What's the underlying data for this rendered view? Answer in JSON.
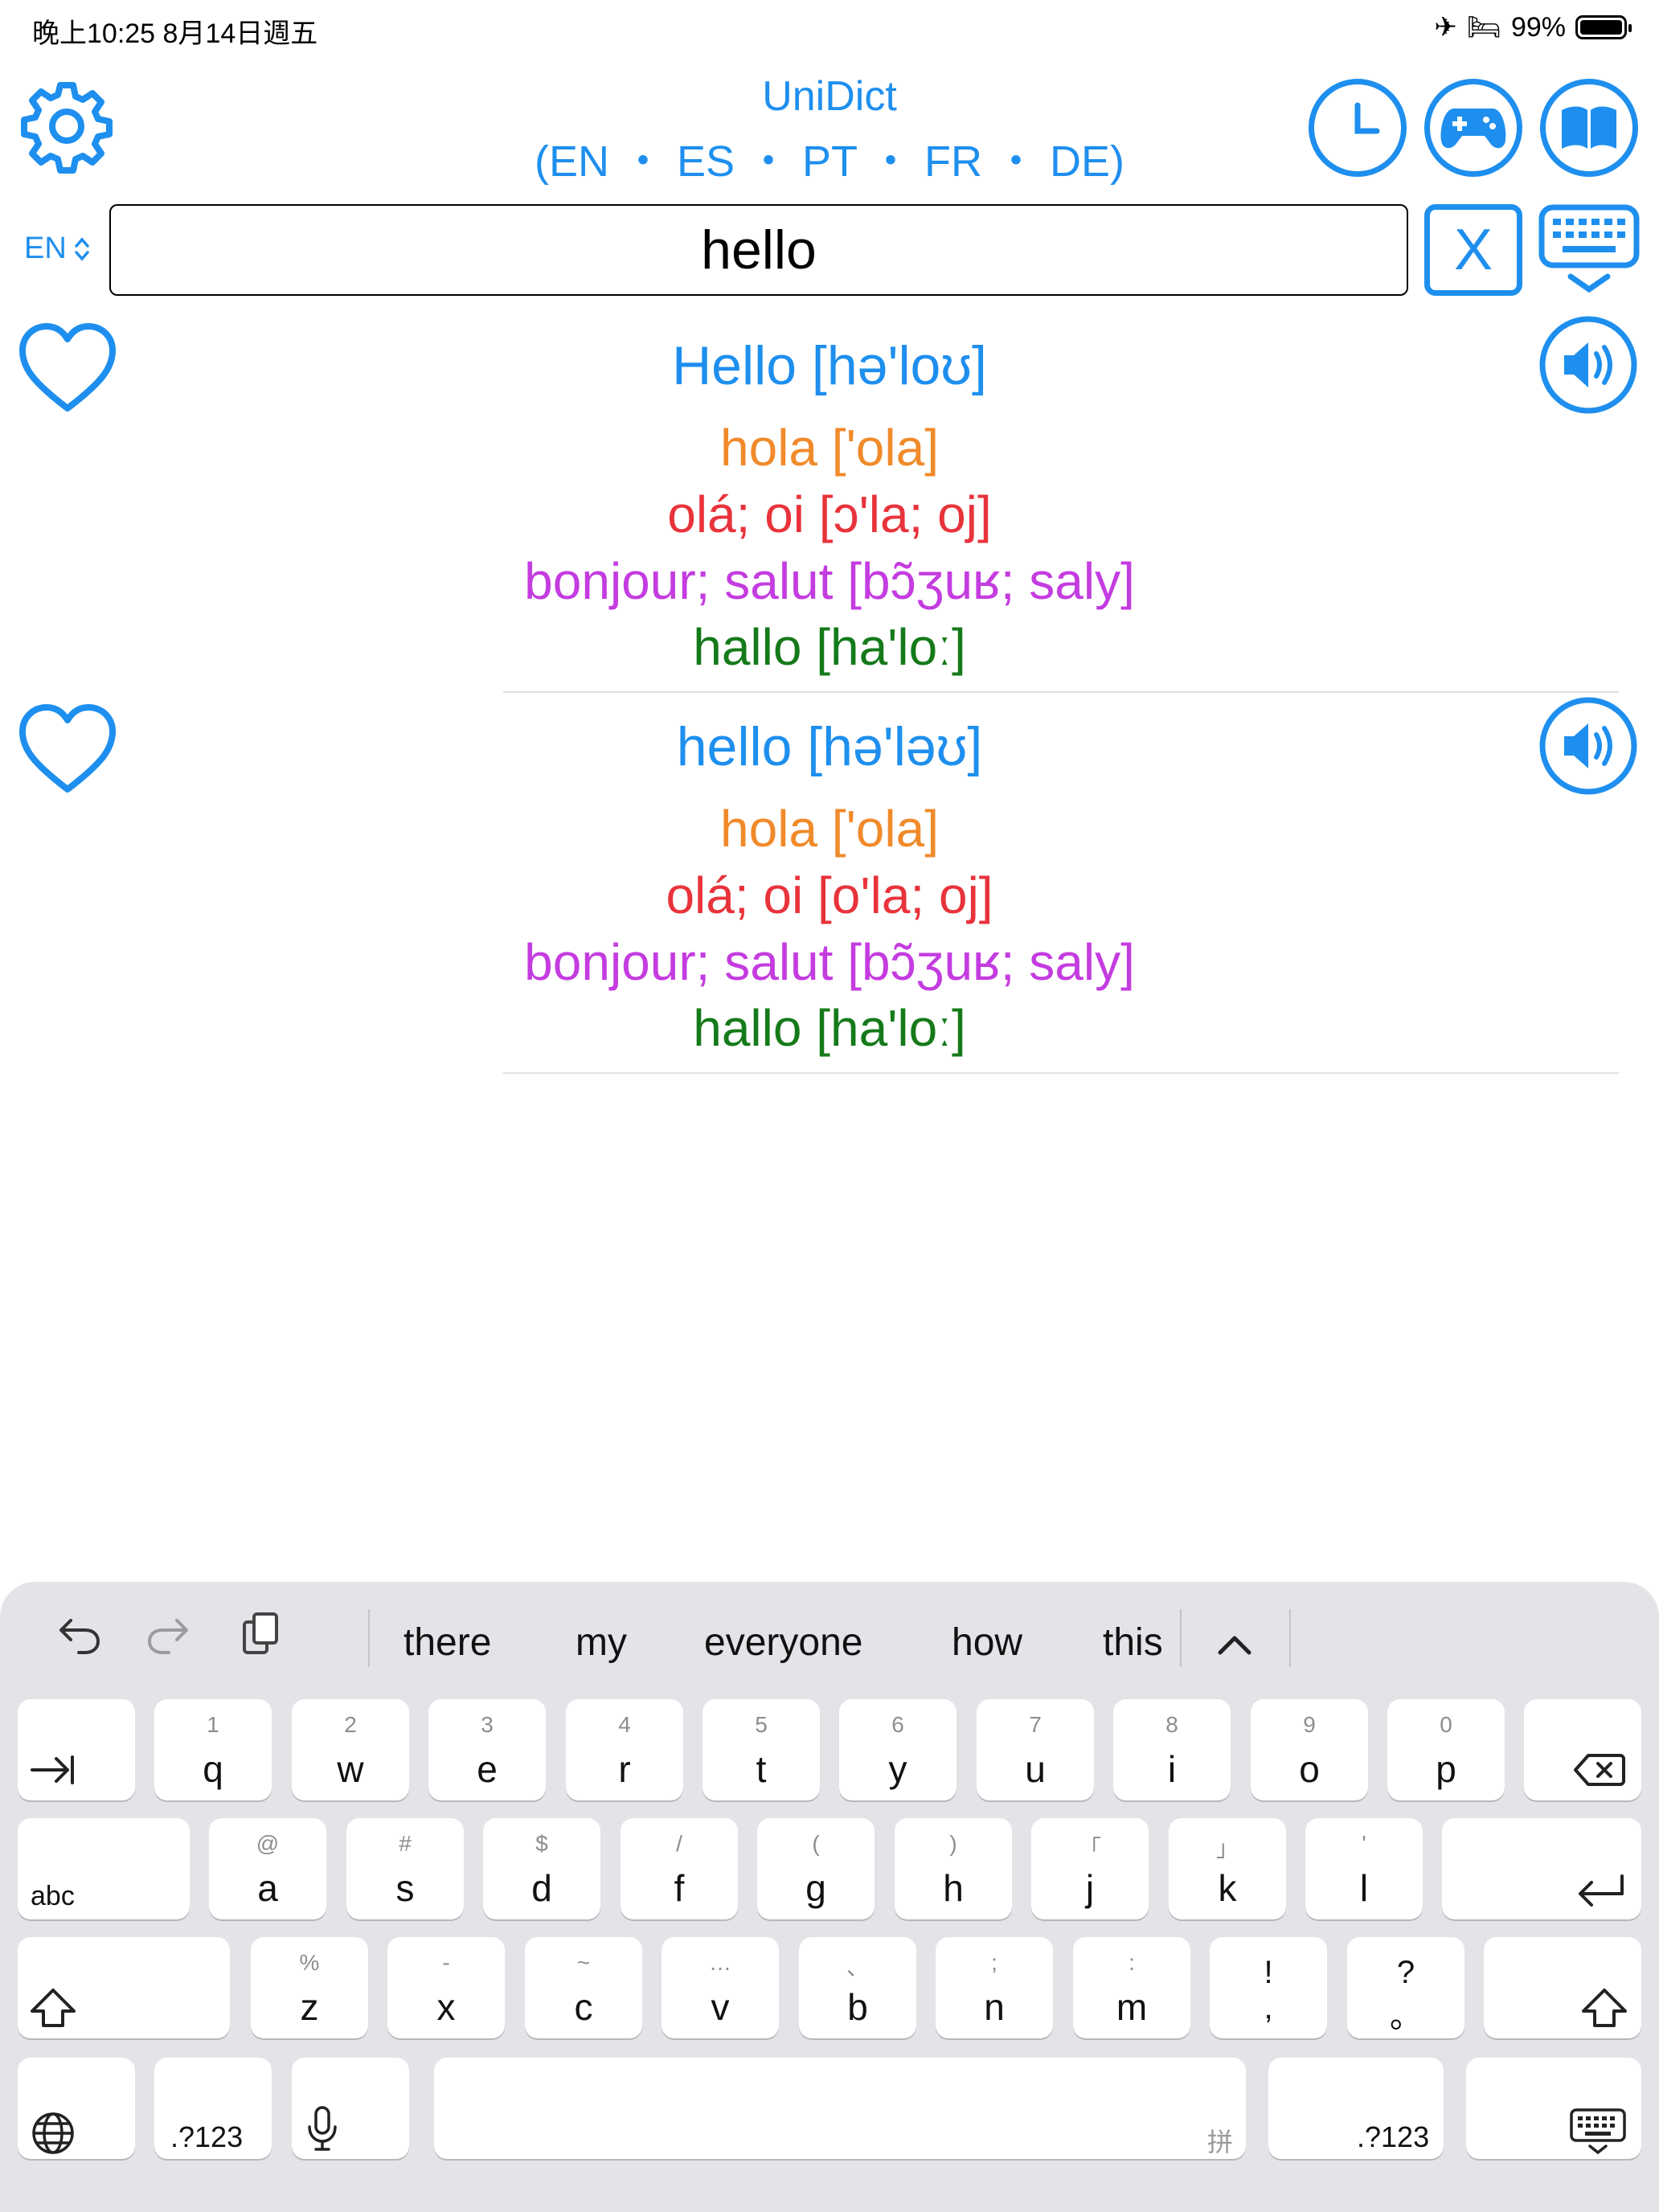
{
  "status_bar": {
    "time": "晚上10:25   8月14日週五",
    "battery_percent": "99%"
  },
  "header": {
    "title": "UniDict",
    "languages": "(EN ・ ES ・ PT ・ FR ・ DE)"
  },
  "search": {
    "language": "EN",
    "query": "hello",
    "clear_label": "X"
  },
  "results": [
    {
      "headword": "Hello [hə'loʊ]",
      "es": "hola ['ola]",
      "pt": "olá; oi [ɔ'la; oj]",
      "fr": "bonjour; salut [bɔ̃ʒuʁ; saly]",
      "de": "hallo [ha'loː]"
    },
    {
      "headword": "hello [hə'ləʊ]",
      "es": "hola ['ola]",
      "pt": "olá; oi [o'la; oj]",
      "fr": "bonjour; salut [bɔ̃ʒuʁ; saly]",
      "de": "hallo [ha'loː]"
    }
  ],
  "keyboard": {
    "suggestions": [
      "there",
      "my",
      "everyone",
      "how",
      "this"
    ],
    "row1": [
      {
        "main": "q",
        "alt": "1"
      },
      {
        "main": "w",
        "alt": "2"
      },
      {
        "main": "e",
        "alt": "3"
      },
      {
        "main": "r",
        "alt": "4"
      },
      {
        "main": "t",
        "alt": "5"
      },
      {
        "main": "y",
        "alt": "6"
      },
      {
        "main": "u",
        "alt": "7"
      },
      {
        "main": "i",
        "alt": "8"
      },
      {
        "main": "o",
        "alt": "9"
      },
      {
        "main": "p",
        "alt": "0"
      }
    ],
    "row2": [
      {
        "main": "a",
        "alt": "@"
      },
      {
        "main": "s",
        "alt": "#"
      },
      {
        "main": "d",
        "alt": "$"
      },
      {
        "main": "f",
        "alt": "/"
      },
      {
        "main": "g",
        "alt": "("
      },
      {
        "main": "h",
        "alt": ")"
      },
      {
        "main": "j",
        "alt": "「"
      },
      {
        "main": "k",
        "alt": "」"
      },
      {
        "main": "l",
        "alt": "'"
      }
    ],
    "row3": [
      {
        "main": "z",
        "alt": "%"
      },
      {
        "main": "x",
        "alt": "-"
      },
      {
        "main": "c",
        "alt": "~"
      },
      {
        "main": "v",
        "alt": "…"
      },
      {
        "main": "b",
        "alt": "、"
      },
      {
        "main": "n",
        "alt": ";"
      },
      {
        "main": "m",
        "alt": ":"
      },
      {
        "main": ",",
        "alt": "!"
      },
      {
        "main": "。",
        "alt": "?"
      }
    ],
    "abc_label": "abc",
    "numbers_label": ".?123",
    "space_hint": "拼"
  }
}
